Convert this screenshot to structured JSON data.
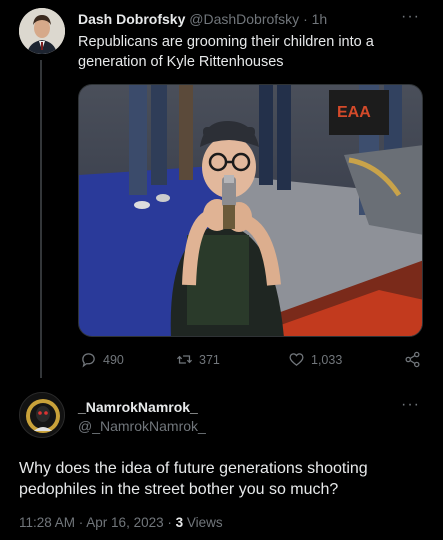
{
  "tweet": {
    "display_name": "Dash Dobrofsky",
    "handle": "@DashDobrofsky",
    "separator": "·",
    "time": "1h",
    "text": "Republicans are grooming their children into a generation of Kyle Rittenhouses",
    "photo_sign_text": "EAA",
    "stats": {
      "replies": "490",
      "retweets": "371",
      "likes": "1,033"
    },
    "icons": [
      "reply-icon",
      "retweet-icon",
      "like-icon",
      "share-icon",
      "more-icon"
    ]
  },
  "reply": {
    "display_name": "_NamrokNamrok_",
    "handle": "@_NamrokNamrok_",
    "text": "Why does the idea of future generations shooting pedophiles in the street bother you so much?",
    "timestamp": "11:28 AM · Apr 16, 2023 ·",
    "views_count": "3",
    "views_label": "Views"
  },
  "colors": {
    "background": "#000000",
    "text_primary": "#e7e9ea",
    "text_secondary": "#71767b",
    "divider": "#333639"
  }
}
